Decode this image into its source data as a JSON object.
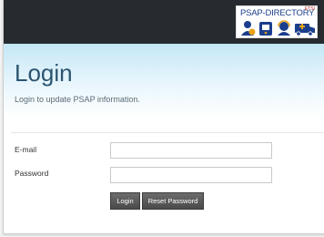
{
  "header": {
    "logo_text": "PSAP-DIRECTORY",
    "logo_mark": "ETSI"
  },
  "page": {
    "title": "Login",
    "subtitle": "Login to update PSAP information."
  },
  "form": {
    "email_label": "E-mail",
    "email_value": "",
    "password_label": "Password",
    "password_value": "",
    "login_label": "Login",
    "reset_label": "Reset Password"
  },
  "icons": [
    "person-icon",
    "phone-icon",
    "headset-operator-icon",
    "ambulance-icon"
  ],
  "colors": {
    "topbar": "#272b30",
    "title": "#2b5570",
    "hero_gradient_top": "#c4e7f6",
    "button": "#555555",
    "logo_blue": "#1b3e8c"
  }
}
